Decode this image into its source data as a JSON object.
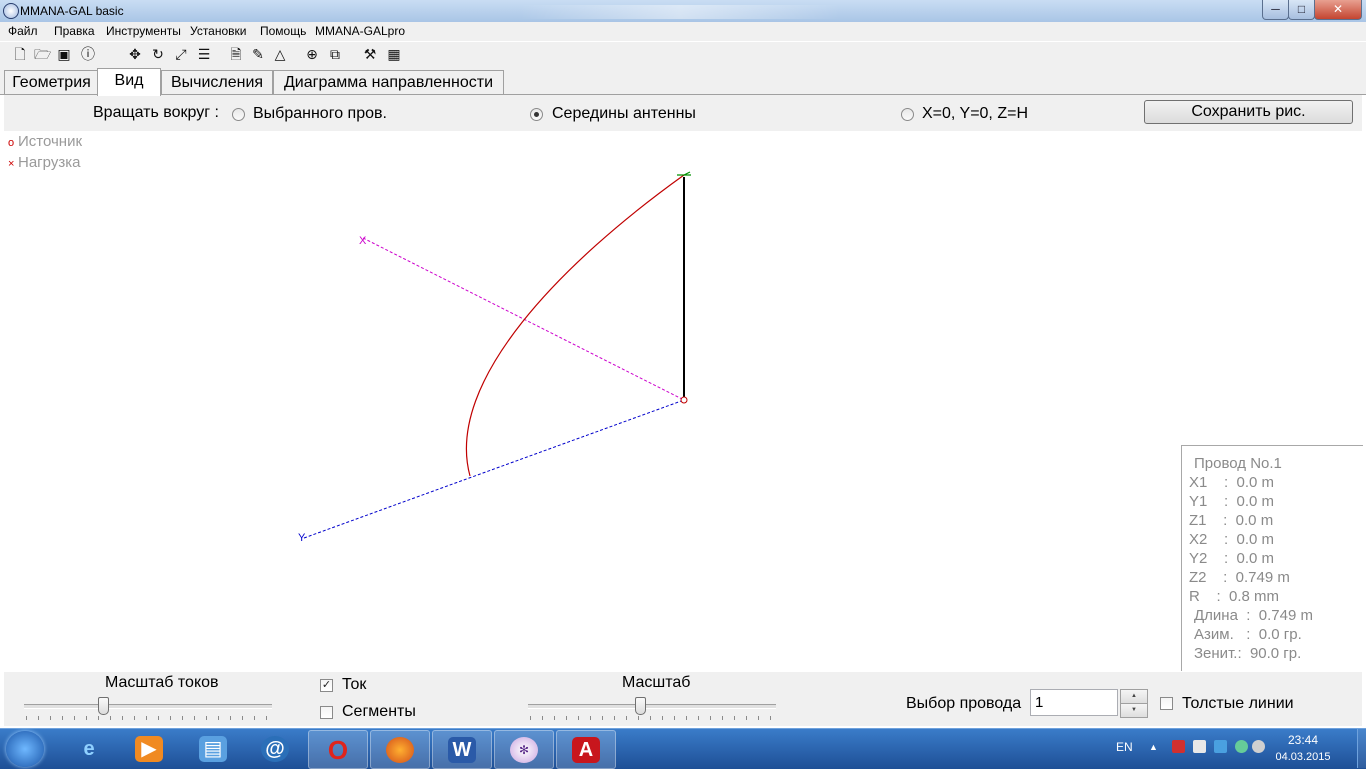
{
  "window": {
    "title": "MMANA-GAL basic",
    "controls": {
      "minimize": "─",
      "maximize": "□",
      "close": "✕"
    }
  },
  "menu": [
    "Файл",
    "Правка",
    "Инструменты",
    "Установки",
    "Помощь",
    "MMANA-GALpro"
  ],
  "toolbar_icons": [
    "new-file-icon",
    "open-folder-icon",
    "save-icon",
    "info-icon",
    "move-icon",
    "rotate-icon",
    "scale-icon",
    "align-icon",
    "document-icon",
    "edit-icon",
    "triangle-icon",
    "target-icon",
    "copy-icon",
    "tools-icon",
    "calculator-icon"
  ],
  "tabs": [
    {
      "label": "Геометрия",
      "active": false
    },
    {
      "label": "Вид",
      "active": true
    },
    {
      "label": "Вычисления",
      "active": false
    },
    {
      "label": "Диаграмма направленности",
      "active": false
    }
  ],
  "rotate": {
    "label": "Вращать вокруг :",
    "options": [
      {
        "label": "Выбранного пров.",
        "selected": false
      },
      {
        "label": "Середины антенны",
        "selected": true
      },
      {
        "label": "X=0, Y=0, Z=H",
        "selected": false
      }
    ],
    "save_button": "Сохранить рис."
  },
  "legend": {
    "source": "Источник",
    "source_mark": "o",
    "load": "Нагрузка",
    "load_mark": "×"
  },
  "axes": {
    "x": "X",
    "y": "Y"
  },
  "colors": {
    "wire": "#000000",
    "current": "#c00000",
    "x_axis": "#cc00cc",
    "y_axis": "#0000cc",
    "z_marker": "#009000"
  },
  "wire_info": {
    "title": "Провод No.1",
    "x1": "X1    :  0.0 m",
    "y1": "Y1    :  0.0 m",
    "z1": "Z1    :  0.0 m",
    "x2": "X2    :  0.0 m",
    "y2": "Y2    :  0.0 m",
    "z2": "Z2    :  0.749 m",
    "r": "R    :  0.8 mm",
    "length": "Длина  :  0.749 m",
    "azimuth": "Азим.   :  0.0 гр.",
    "zenith": "Зенит.:  90.0 гр."
  },
  "bottom": {
    "current_scale_label": "Масштаб токов",
    "current_scale_value": 0.32,
    "current_checkbox": {
      "label": "Ток",
      "checked": true
    },
    "segments_checkbox": {
      "label": "Сегменты",
      "checked": false
    },
    "scale_label": "Масштаб",
    "scale_value": 0.45,
    "wire_select_label": "Выбор провода",
    "wire_select_value": "1",
    "thick_lines": {
      "label": "Толстые линии",
      "checked": false
    }
  },
  "taskbar": {
    "apps": [
      "internet-explorer-icon",
      "media-player-icon",
      "file-manager-icon",
      "chat-icon",
      "opera-icon",
      "firefox-icon",
      "word-icon",
      "mmana-icon",
      "acrobat-icon"
    ],
    "language": "EN",
    "time": "23:44",
    "date": "04.03.2015"
  }
}
